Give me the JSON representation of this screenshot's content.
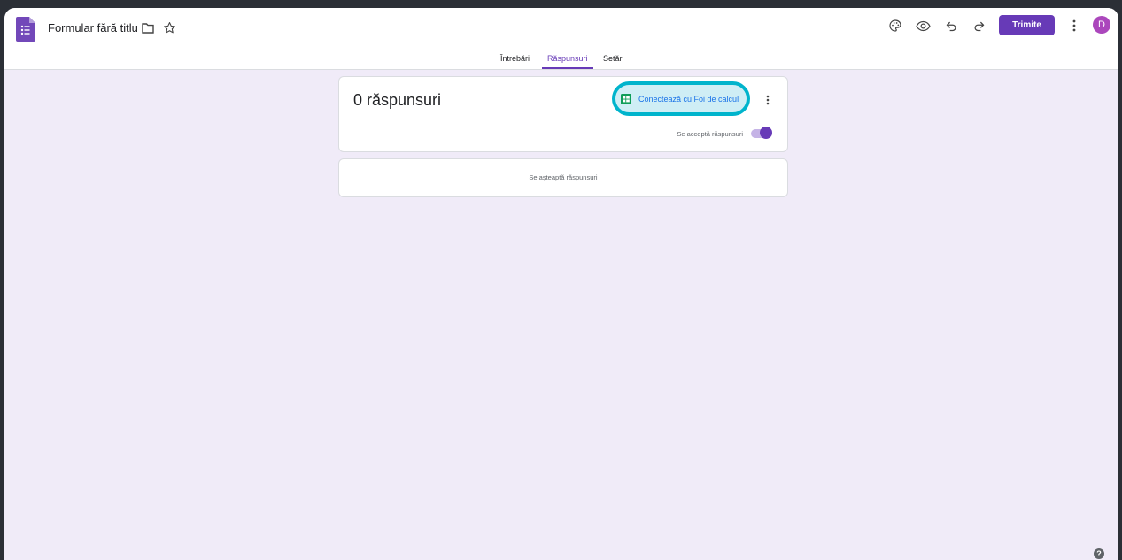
{
  "header": {
    "title": "Formular fără titlu",
    "send_label": "Trimite",
    "avatar_initial": "D"
  },
  "tabs": [
    {
      "label": "Întrebări",
      "active": false
    },
    {
      "label": "Răspunsuri",
      "active": true
    },
    {
      "label": "Setări",
      "active": false
    }
  ],
  "responses": {
    "count_label": "0 răspunsuri",
    "connect_label": "Conectează cu Foi de calcul",
    "accepting_label": "Se acceptă răspunsuri",
    "accepting": true,
    "awaiting_label": "Se așteaptă răspunsuri"
  },
  "help_label": "?",
  "icons": {
    "logo": "forms-logo-icon",
    "folder": "folder-icon",
    "star": "star-icon",
    "palette": "palette-icon",
    "preview": "eye-icon",
    "undo": "undo-icon",
    "redo": "redo-icon",
    "more": "more-vert-icon",
    "sheets": "sheets-icon",
    "help": "help-icon"
  },
  "colors": {
    "accent": "#673ab7",
    "background": "#f0ebf8",
    "highlight_ring": "#00b4cc",
    "sheets_green": "#0f9d58"
  }
}
